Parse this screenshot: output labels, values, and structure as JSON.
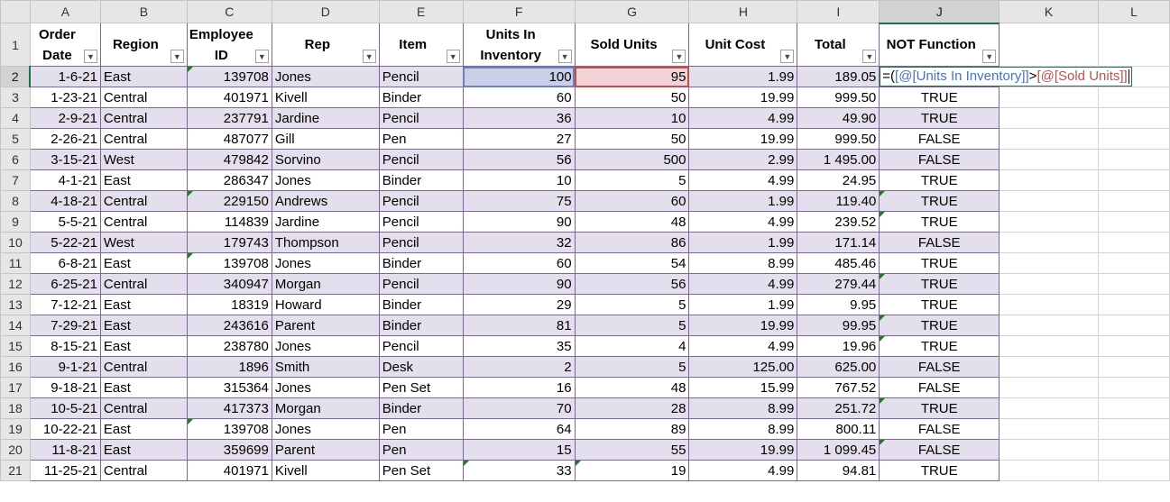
{
  "columns": [
    "A",
    "B",
    "C",
    "D",
    "E",
    "F",
    "G",
    "H",
    "I",
    "J",
    "K",
    "L"
  ],
  "selected_column": "J",
  "active_row": "2",
  "headers": {
    "order_date_l1": "Order",
    "order_date_l2": "Date",
    "region": "Region",
    "employee_id_l1": "Employee",
    "employee_id_l2": "ID",
    "rep": "Rep",
    "item": "Item",
    "units_in_inventory_l1": "Units In",
    "units_in_inventory_l2": "Inventory",
    "sold_units": "Sold Units",
    "unit_cost": "Unit Cost",
    "total": "Total",
    "not_function": "NOT Function"
  },
  "formula": {
    "prefix": "=(",
    "ref1": "[@[Units In Inventory]]",
    "operator": ">",
    "ref2": "[@[Sold Units]]"
  },
  "rows": [
    {
      "row": "2",
      "date": "1-6-21",
      "region": "East",
      "emp": "139708",
      "rep": "Jones",
      "item": "Pencil",
      "inv": "100",
      "sold": "95",
      "cost": "1.99",
      "total": "189.05",
      "flag": ""
    },
    {
      "row": "3",
      "date": "1-23-21",
      "region": "Central",
      "emp": "401971",
      "rep": "Kivell",
      "item": "Binder",
      "inv": "60",
      "sold": "50",
      "cost": "19.99",
      "total": "999.50",
      "flag": "TRUE"
    },
    {
      "row": "4",
      "date": "2-9-21",
      "region": "Central",
      "emp": "237791",
      "rep": "Jardine",
      "item": "Pencil",
      "inv": "36",
      "sold": "10",
      "cost": "4.99",
      "total": "49.90",
      "flag": "TRUE"
    },
    {
      "row": "5",
      "date": "2-26-21",
      "region": "Central",
      "emp": "487077",
      "rep": "Gill",
      "item": "Pen",
      "inv": "27",
      "sold": "50",
      "cost": "19.99",
      "total": "999.50",
      "flag": "FALSE"
    },
    {
      "row": "6",
      "date": "3-15-21",
      "region": "West",
      "emp": "479842",
      "rep": "Sorvino",
      "item": "Pencil",
      "inv": "56",
      "sold": "500",
      "cost": "2.99",
      "total": "1 495.00",
      "flag": "FALSE"
    },
    {
      "row": "7",
      "date": "4-1-21",
      "region": "East",
      "emp": "286347",
      "rep": "Jones",
      "item": "Binder",
      "inv": "10",
      "sold": "5",
      "cost": "4.99",
      "total": "24.95",
      "flag": "TRUE"
    },
    {
      "row": "8",
      "date": "4-18-21",
      "region": "Central",
      "emp": "229150",
      "rep": "Andrews",
      "item": "Pencil",
      "inv": "75",
      "sold": "60",
      "cost": "1.99",
      "total": "119.40",
      "flag": "TRUE"
    },
    {
      "row": "9",
      "date": "5-5-21",
      "region": "Central",
      "emp": "114839",
      "rep": "Jardine",
      "item": "Pencil",
      "inv": "90",
      "sold": "48",
      "cost": "4.99",
      "total": "239.52",
      "flag": "TRUE"
    },
    {
      "row": "10",
      "date": "5-22-21",
      "region": "West",
      "emp": "179743",
      "rep": "Thompson",
      "item": "Pencil",
      "inv": "32",
      "sold": "86",
      "cost": "1.99",
      "total": "171.14",
      "flag": "FALSE"
    },
    {
      "row": "11",
      "date": "6-8-21",
      "region": "East",
      "emp": "139708",
      "rep": "Jones",
      "item": "Binder",
      "inv": "60",
      "sold": "54",
      "cost": "8.99",
      "total": "485.46",
      "flag": "TRUE"
    },
    {
      "row": "12",
      "date": "6-25-21",
      "region": "Central",
      "emp": "340947",
      "rep": "Morgan",
      "item": "Pencil",
      "inv": "90",
      "sold": "56",
      "cost": "4.99",
      "total": "279.44",
      "flag": "TRUE"
    },
    {
      "row": "13",
      "date": "7-12-21",
      "region": "East",
      "emp": "18319",
      "rep": "Howard",
      "item": "Binder",
      "inv": "29",
      "sold": "5",
      "cost": "1.99",
      "total": "9.95",
      "flag": "TRUE"
    },
    {
      "row": "14",
      "date": "7-29-21",
      "region": "East",
      "emp": "243616",
      "rep": "Parent",
      "item": "Binder",
      "inv": "81",
      "sold": "5",
      "cost": "19.99",
      "total": "99.95",
      "flag": "TRUE"
    },
    {
      "row": "15",
      "date": "8-15-21",
      "region": "East",
      "emp": "238780",
      "rep": "Jones",
      "item": "Pencil",
      "inv": "35",
      "sold": "4",
      "cost": "4.99",
      "total": "19.96",
      "flag": "TRUE"
    },
    {
      "row": "16",
      "date": "9-1-21",
      "region": "Central",
      "emp": "1896",
      "rep": "Smith",
      "item": "Desk",
      "inv": "2",
      "sold": "5",
      "cost": "125.00",
      "total": "625.00",
      "flag": "FALSE"
    },
    {
      "row": "17",
      "date": "9-18-21",
      "region": "East",
      "emp": "315364",
      "rep": "Jones",
      "item": "Pen Set",
      "inv": "16",
      "sold": "48",
      "cost": "15.99",
      "total": "767.52",
      "flag": "FALSE"
    },
    {
      "row": "18",
      "date": "10-5-21",
      "region": "Central",
      "emp": "417373",
      "rep": "Morgan",
      "item": "Binder",
      "inv": "70",
      "sold": "28",
      "cost": "8.99",
      "total": "251.72",
      "flag": "TRUE"
    },
    {
      "row": "19",
      "date": "10-22-21",
      "region": "East",
      "emp": "139708",
      "rep": "Jones",
      "item": "Pen",
      "inv": "64",
      "sold": "89",
      "cost": "8.99",
      "total": "800.11",
      "flag": "FALSE"
    },
    {
      "row": "20",
      "date": "11-8-21",
      "region": "East",
      "emp": "359699",
      "rep": "Parent",
      "item": "Pen",
      "inv": "15",
      "sold": "55",
      "cost": "19.99",
      "total": "1 099.45",
      "flag": "FALSE"
    },
    {
      "row": "21",
      "date": "11-25-21",
      "region": "Central",
      "emp": "401971",
      "rep": "Kivell",
      "item": "Pen Set",
      "inv": "33",
      "sold": "19",
      "cost": "4.99",
      "total": "94.81",
      "flag": "TRUE"
    }
  ]
}
